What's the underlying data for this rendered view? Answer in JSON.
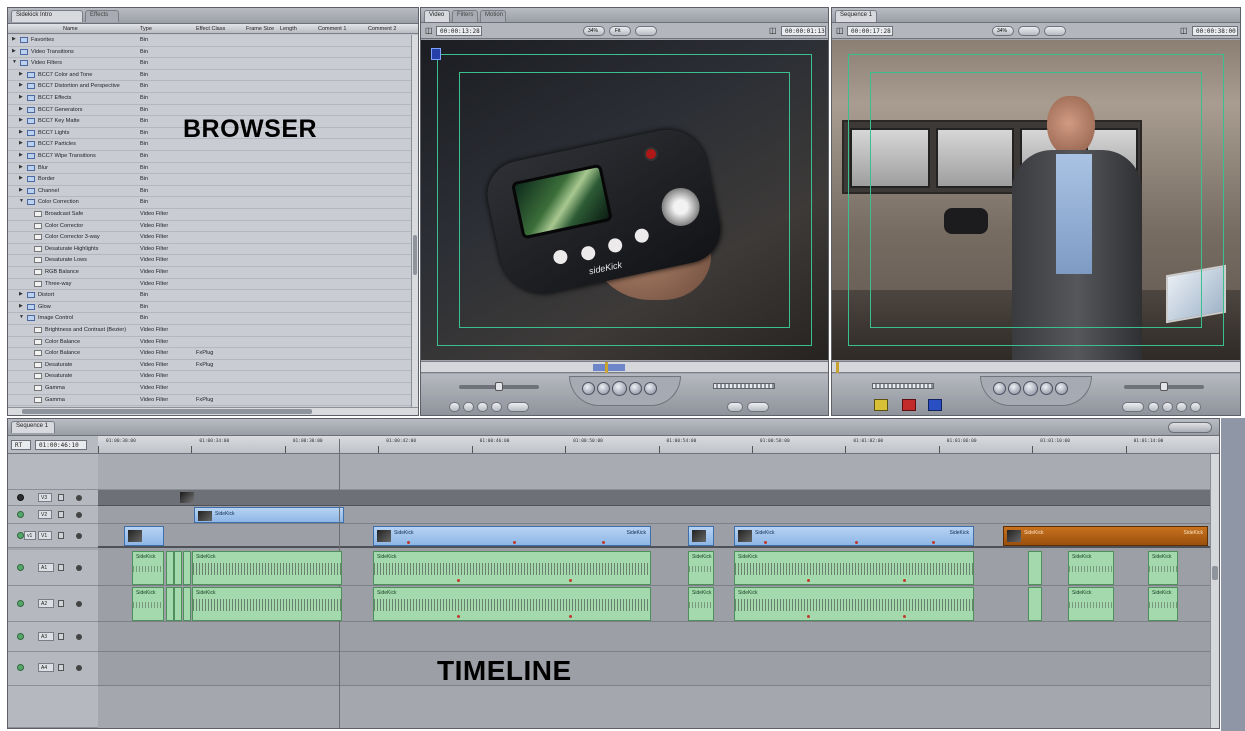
{
  "browser": {
    "tabs": [
      "Sidekick Intro",
      "Effects"
    ],
    "columns": [
      "Name",
      "Type",
      "Effect Class",
      "Frame Size",
      "Length",
      "Comment 1",
      "Comment 2"
    ],
    "rows": [
      {
        "name": "Favorites",
        "type": "Bin",
        "class": "",
        "indent": 0,
        "kind": "folder",
        "open": false
      },
      {
        "name": "Video Transitions",
        "type": "Bin",
        "class": "",
        "indent": 0,
        "kind": "folder",
        "open": false
      },
      {
        "name": "Video Filters",
        "type": "Bin",
        "class": "",
        "indent": 0,
        "kind": "folder",
        "open": true
      },
      {
        "name": "BCC7 Color and Tone",
        "type": "Bin",
        "class": "",
        "indent": 1,
        "kind": "folder",
        "open": false
      },
      {
        "name": "BCC7 Distortion and Perspective",
        "type": "Bin",
        "class": "",
        "indent": 1,
        "kind": "folder",
        "open": false
      },
      {
        "name": "BCC7 Effects",
        "type": "Bin",
        "class": "",
        "indent": 1,
        "kind": "folder",
        "open": false
      },
      {
        "name": "BCC7 Generators",
        "type": "Bin",
        "class": "",
        "indent": 1,
        "kind": "folder",
        "open": false
      },
      {
        "name": "BCC7 Key Matte",
        "type": "Bin",
        "class": "",
        "indent": 1,
        "kind": "folder",
        "open": false
      },
      {
        "name": "BCC7 Lights",
        "type": "Bin",
        "class": "",
        "indent": 1,
        "kind": "folder",
        "open": false
      },
      {
        "name": "BCC7 Particles",
        "type": "Bin",
        "class": "",
        "indent": 1,
        "kind": "folder",
        "open": false
      },
      {
        "name": "BCC7 Wipe Transitions",
        "type": "Bin",
        "class": "",
        "indent": 1,
        "kind": "folder",
        "open": false
      },
      {
        "name": "Blur",
        "type": "Bin",
        "class": "",
        "indent": 1,
        "kind": "folder",
        "open": false
      },
      {
        "name": "Border",
        "type": "Bin",
        "class": "",
        "indent": 1,
        "kind": "folder",
        "open": false
      },
      {
        "name": "Channel",
        "type": "Bin",
        "class": "",
        "indent": 1,
        "kind": "folder",
        "open": false
      },
      {
        "name": "Color Correction",
        "type": "Bin",
        "class": "",
        "indent": 1,
        "kind": "folder",
        "open": true
      },
      {
        "name": "Broadcast Safe",
        "type": "Video Filter",
        "class": "",
        "indent": 2,
        "kind": "clip",
        "open": false
      },
      {
        "name": "Color Corrector",
        "type": "Video Filter",
        "class": "",
        "indent": 2,
        "kind": "clip",
        "open": false
      },
      {
        "name": "Color Corrector 3-way",
        "type": "Video Filter",
        "class": "",
        "indent": 2,
        "kind": "clip",
        "open": false
      },
      {
        "name": "Desaturate Highlights",
        "type": "Video Filter",
        "class": "",
        "indent": 2,
        "kind": "clip",
        "open": false
      },
      {
        "name": "Desaturate Lows",
        "type": "Video Filter",
        "class": "",
        "indent": 2,
        "kind": "clip",
        "open": false
      },
      {
        "name": "RGB Balance",
        "type": "Video Filter",
        "class": "",
        "indent": 2,
        "kind": "clip",
        "open": false
      },
      {
        "name": "Three-way",
        "type": "Video Filter",
        "class": "",
        "indent": 2,
        "kind": "clip",
        "open": false
      },
      {
        "name": "Distort",
        "type": "Bin",
        "class": "",
        "indent": 1,
        "kind": "folder",
        "open": false
      },
      {
        "name": "Glow",
        "type": "Bin",
        "class": "",
        "indent": 1,
        "kind": "folder",
        "open": false
      },
      {
        "name": "Image Control",
        "type": "Bin",
        "class": "",
        "indent": 1,
        "kind": "folder",
        "open": true
      },
      {
        "name": "Brightness and Contrast (Bezier)",
        "type": "Video Filter",
        "class": "",
        "indent": 2,
        "kind": "clip",
        "open": false
      },
      {
        "name": "Color Balance",
        "type": "Video Filter",
        "class": "",
        "indent": 2,
        "kind": "clip",
        "open": false
      },
      {
        "name": "Color Balance",
        "type": "Video Filter",
        "class": "FxPlug",
        "indent": 2,
        "kind": "clip",
        "open": false
      },
      {
        "name": "Desaturate",
        "type": "Video Filter",
        "class": "FxPlug",
        "indent": 2,
        "kind": "clip",
        "open": false
      },
      {
        "name": "Desaturate",
        "type": "Video Filter",
        "class": "",
        "indent": 2,
        "kind": "clip",
        "open": false
      },
      {
        "name": "Gamma",
        "type": "Video Filter",
        "class": "",
        "indent": 2,
        "kind": "clip",
        "open": false
      },
      {
        "name": "Gamma",
        "type": "Video Filter",
        "class": "FxPlug",
        "indent": 2,
        "kind": "clip",
        "open": false
      }
    ]
  },
  "viewer": {
    "tabs": [
      "Video",
      "Filters",
      "Motion"
    ],
    "timecode_left": "00:00:13:28",
    "timecode_right": "00:00:01:13",
    "zoom": "34%",
    "view": "Fit",
    "device_brand": "sideKick"
  },
  "canvas": {
    "tabs": [
      "Sequence 1"
    ],
    "timecode_left": "00:00:17:28",
    "timecode_right": "00:00:38:00",
    "zoom": "34%"
  },
  "timeline": {
    "tabs": [
      "Sequence 1"
    ],
    "current_timecode": "01:00:46:10",
    "rt_label": "RT",
    "ruler_ticks": [
      "01:00:30:00",
      "01:00:34:00",
      "01:00:38:00",
      "01:00:42:00",
      "01:00:46:00",
      "01:00:50:00",
      "01:00:54:00",
      "01:00:58:00",
      "01:01:02:00",
      "01:01:06:00",
      "01:01:10:00",
      "01:01:14:00"
    ],
    "video_tracks": [
      "V3",
      "V2",
      "V1"
    ],
    "audio_tracks": [
      "A1",
      "A2",
      "A3",
      "A4"
    ],
    "source_video": "v1",
    "source_audio": "a1",
    "clip_name": "SideKick",
    "audio_clip_name": "SideKick"
  },
  "overlay": {
    "browser_label": "BROWSER",
    "timeline_label": "TIMELINE"
  },
  "colors": {
    "title_safe": "#3bbf8e",
    "video_clip": "#9cc2ec",
    "audio_clip": "#a3d9ad",
    "brown_clip": "#b2631a",
    "window_chrome": "#a3a6ad"
  }
}
